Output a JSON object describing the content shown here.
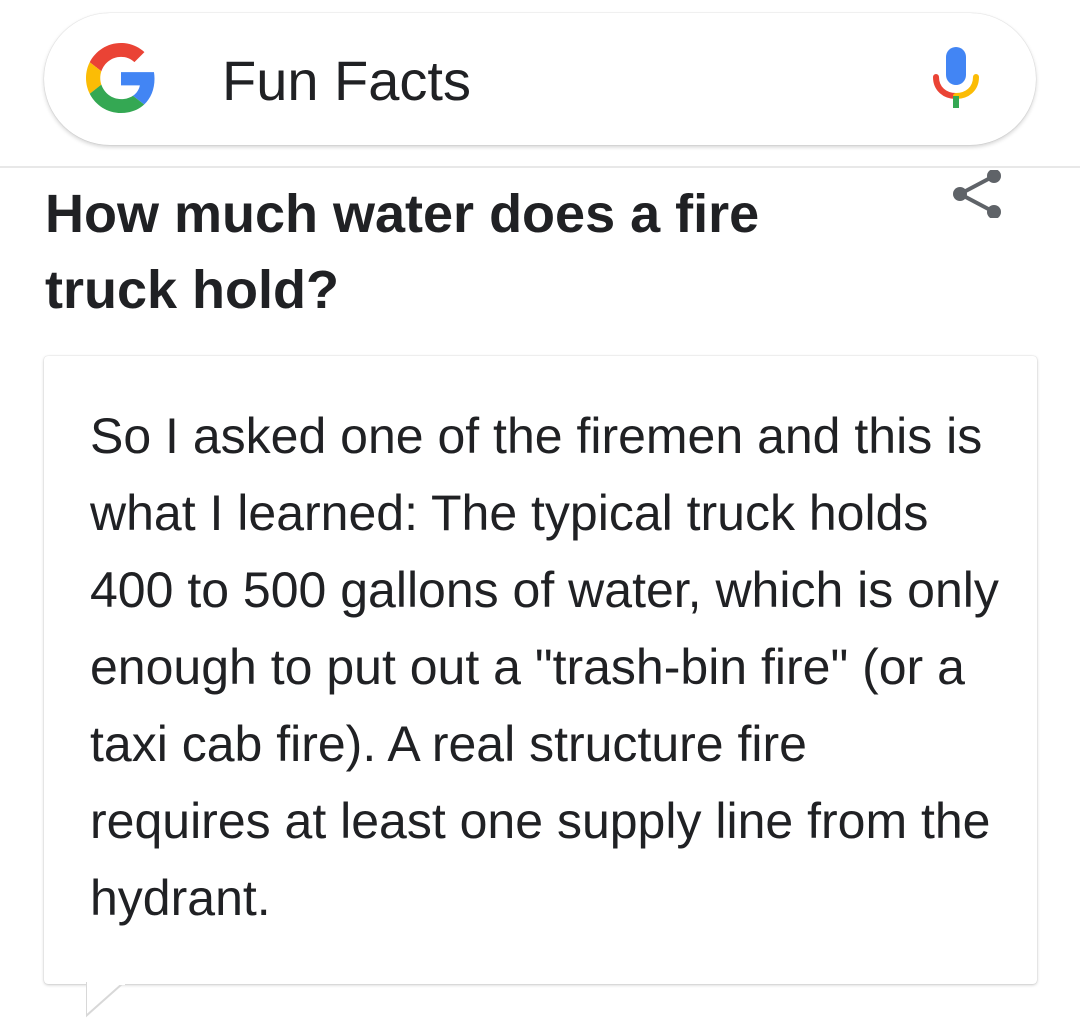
{
  "search": {
    "query": "Fun Facts",
    "logo_icon": "google-g-icon",
    "mic_icon": "microphone-icon"
  },
  "question": {
    "title": "How much water does a fire truck hold?",
    "share_icon": "share-icon"
  },
  "answer": {
    "text": "So I asked one of the firemen and this is what I learned: The typical truck holds 400 to 500 gallons of water, which is only enough to put out a \"trash-bin fire\" (or a taxi cab fire). A real structure fire requires at least one supply line from the hydrant."
  },
  "colors": {
    "google_blue": "#4285F4",
    "google_red": "#EA4335",
    "google_yellow": "#FBBC05",
    "google_green": "#34A853",
    "text_dark": "#202124",
    "icon_gray": "#5f6368"
  }
}
